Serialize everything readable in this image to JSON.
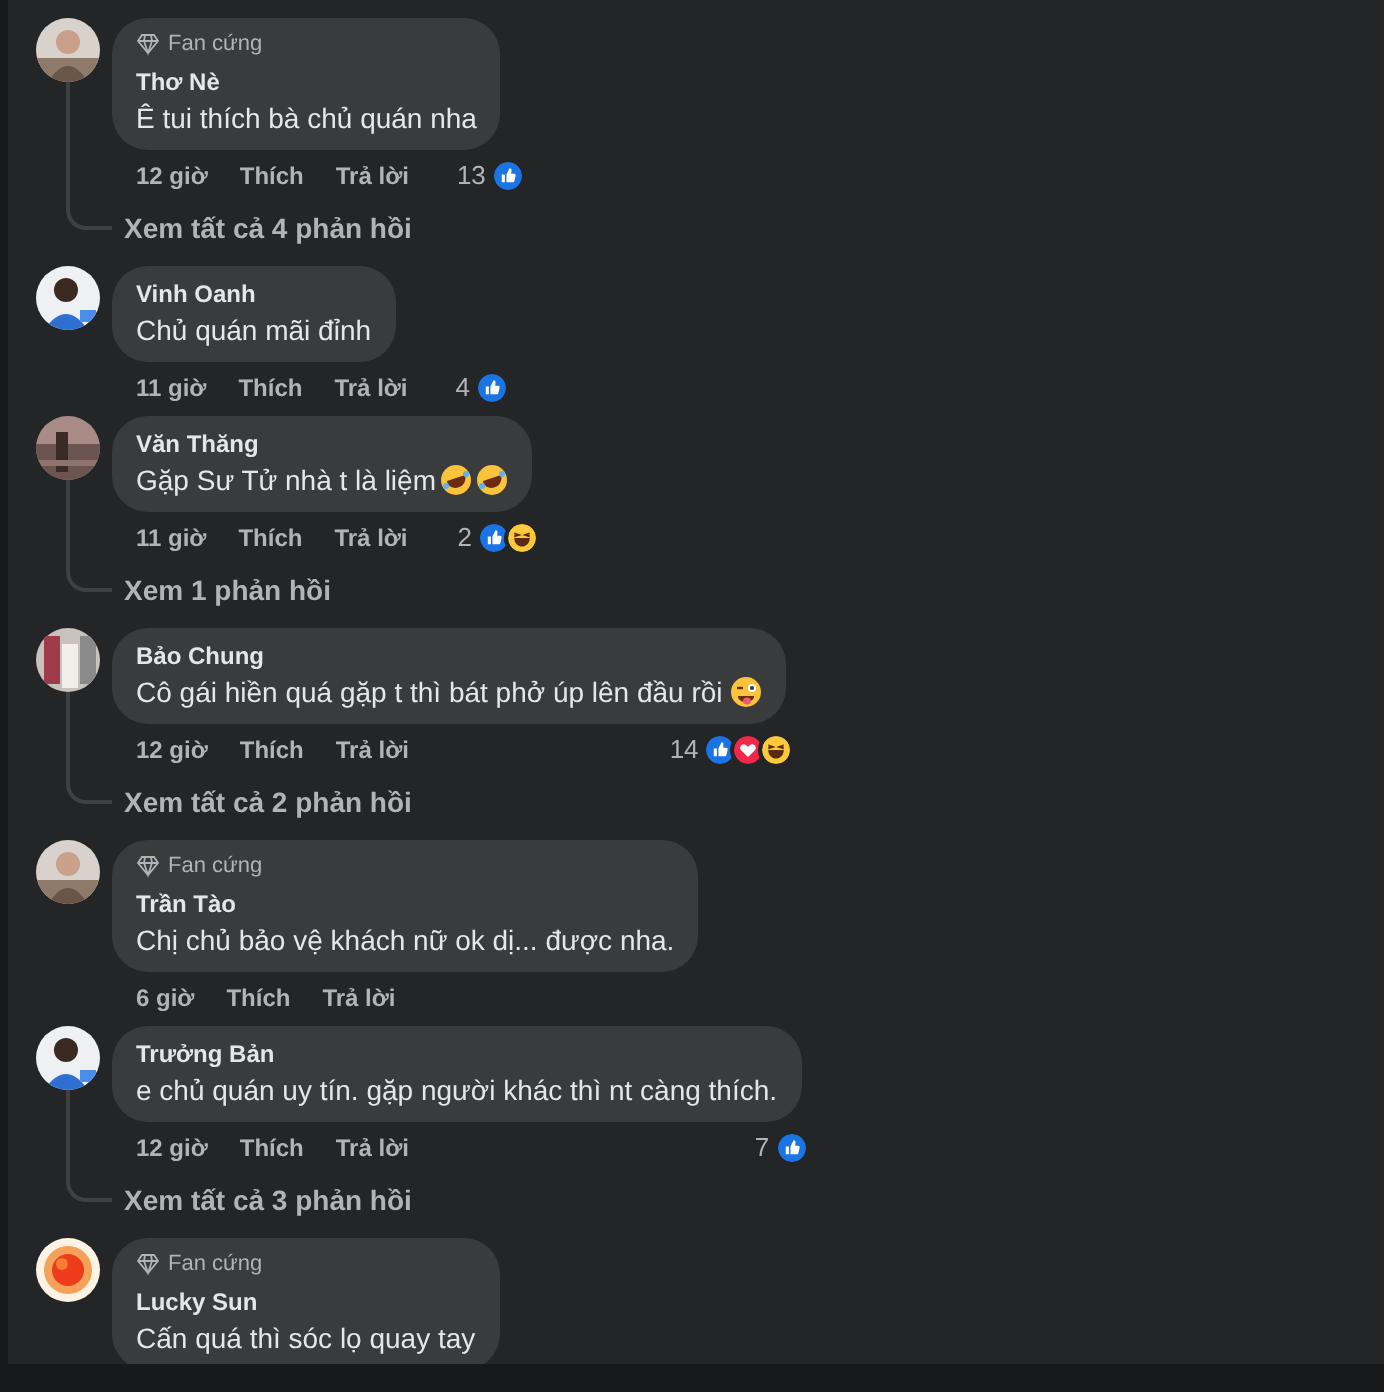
{
  "comments": [
    {
      "badge": "Fan cứng",
      "name": "Thơ Nè",
      "text": "Ê tui thích bà chủ quán nha",
      "time": "12 giờ",
      "like": "Thích",
      "reply": "Trả lời",
      "reaction_count": "13",
      "reactions": [
        {
          "kind": "like"
        }
      ],
      "replies_link": "Xem tất cả 4 phản hồi"
    },
    {
      "name": "Vinh Oanh",
      "text": "Chủ quán mãi đỉnh",
      "time": "11 giờ",
      "like": "Thích",
      "reply": "Trả lời",
      "reaction_count": "4",
      "reactions": [
        {
          "kind": "like"
        }
      ]
    },
    {
      "name": "Văn Thăng",
      "text": "Gặp Sư Tử nhà t là liệm",
      "emoji": [
        {
          "kind": "rofl"
        },
        {
          "kind": "rofl"
        }
      ],
      "time": "11 giờ",
      "like": "Thích",
      "reply": "Trả lời",
      "reaction_count": "2",
      "reactions": [
        {
          "kind": "like"
        },
        {
          "kind": "haha"
        }
      ],
      "replies_link": "Xem 1 phản hồi"
    },
    {
      "name": "Bảo Chung",
      "text": "Cô gái hiền quá gặp t thì bát phở úp lên đầu rồi",
      "emoji": [
        {
          "kind": "wink"
        }
      ],
      "time": "12 giờ",
      "like": "Thích",
      "reply": "Trả lời",
      "reaction_count": "14",
      "reactions": [
        {
          "kind": "like"
        },
        {
          "kind": "love"
        },
        {
          "kind": "haha"
        }
      ],
      "replies_link": "Xem tất cả 2 phản hồi"
    },
    {
      "badge": "Fan cứng",
      "name": "Trần Tào",
      "text": "Chị chủ bảo vệ khách nữ ok dị... được nha.",
      "time": "6 giờ",
      "like": "Thích",
      "reply": "Trả lời"
    },
    {
      "name": "Trưởng Bản",
      "text": "e chủ quán uy tín. gặp người khác thì nt càng thích.",
      "time": "12 giờ",
      "like": "Thích",
      "reply": "Trả lời",
      "reaction_count": "7",
      "reactions": [
        {
          "kind": "like"
        }
      ],
      "replies_link": "Xem tất cả 3 phản hồi"
    },
    {
      "badge": "Fan cứng",
      "name": "Lucky Sun",
      "text": "Cấn quá thì sóc lọ quay tay"
    }
  ]
}
